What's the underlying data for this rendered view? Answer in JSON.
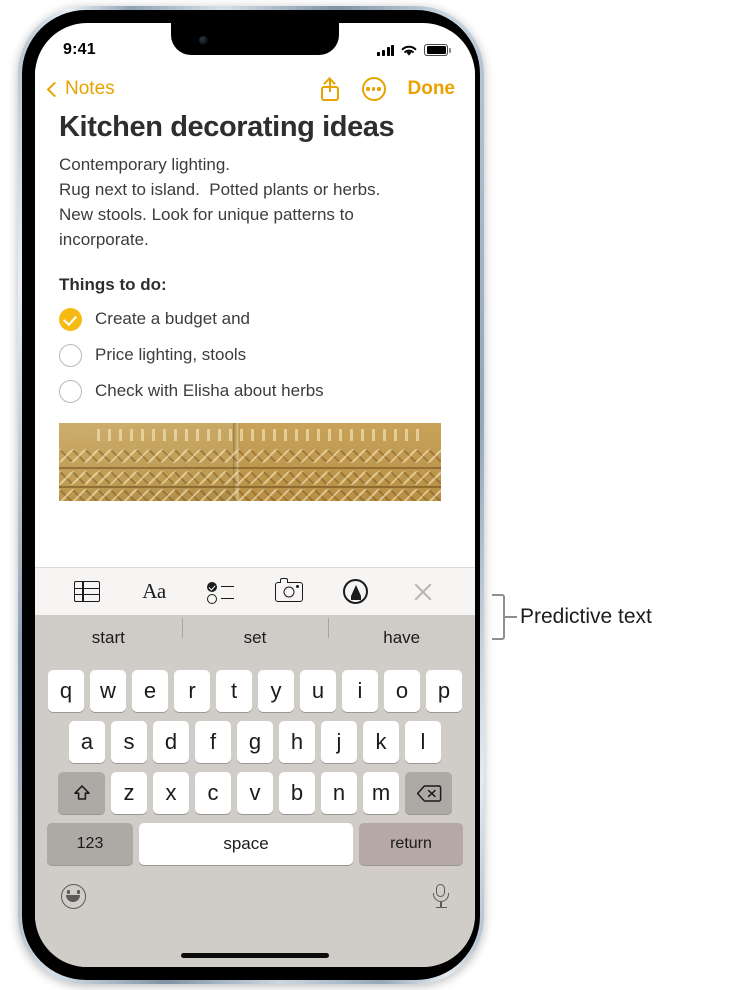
{
  "status_bar": {
    "time": "9:41",
    "cellular_icon": "cellular-bars-icon",
    "wifi_icon": "wifi-icon",
    "battery_icon": "battery-full-icon"
  },
  "nav_bar": {
    "back_label": "Notes",
    "back_icon": "chevron-left-icon",
    "share_icon": "share-icon",
    "more_icon": "more-ellipsis-icon",
    "done_label": "Done",
    "accent_color": "#E8A300"
  },
  "note": {
    "title": "Kitchen decorating ideas",
    "body_lines": [
      "Contemporary lighting.",
      "Rug next to island.  Potted plants or herbs.",
      "New stools. Look for unique patterns to",
      "incorporate."
    ],
    "todo_heading": "Things to do:",
    "todo_items": [
      {
        "label": "Create a budget and",
        "checked": true
      },
      {
        "label": "Price lighting, stools",
        "checked": false
      },
      {
        "label": "Check with Elisha about herbs",
        "checked": false
      }
    ],
    "attachment": "woven-textile-photo",
    "checked_color": "#F5BB12"
  },
  "format_toolbar": {
    "items": [
      {
        "name": "table-icon",
        "label": ""
      },
      {
        "name": "text-format-icon",
        "label": "Aa"
      },
      {
        "name": "checklist-icon",
        "label": ""
      },
      {
        "name": "camera-icon",
        "label": ""
      },
      {
        "name": "markup-pen-icon",
        "label": ""
      },
      {
        "name": "close-icon",
        "label": ""
      }
    ]
  },
  "keyboard": {
    "predictive": [
      "start",
      "set",
      "have"
    ],
    "row1": [
      "q",
      "w",
      "e",
      "r",
      "t",
      "y",
      "u",
      "i",
      "o",
      "p"
    ],
    "row2": [
      "a",
      "s",
      "d",
      "f",
      "g",
      "h",
      "j",
      "k",
      "l"
    ],
    "row3": [
      "z",
      "x",
      "c",
      "v",
      "b",
      "n",
      "m"
    ],
    "shift_icon": "shift-arrow-icon",
    "delete_icon": "delete-backspace-icon",
    "numbers_label": "123",
    "space_label": "space",
    "return_label": "return",
    "emoji_icon": "emoji-smiley-icon",
    "dictation_icon": "microphone-icon"
  },
  "callout": {
    "label": "Predictive text",
    "color": "#8e8e8e"
  }
}
